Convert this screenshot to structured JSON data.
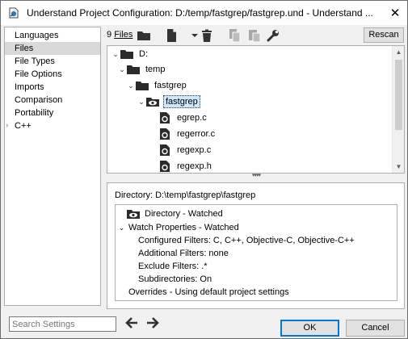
{
  "window": {
    "title": "Understand Project Configuration: D:/temp/fastgrep/fastgrep.und - Understand ...",
    "close_glyph": "✕"
  },
  "sidebar": {
    "items": [
      {
        "label": "Languages"
      },
      {
        "label": "Files"
      },
      {
        "label": "File Types"
      },
      {
        "label": "File Options"
      },
      {
        "label": "Imports"
      },
      {
        "label": "Comparison"
      },
      {
        "label": "Portability"
      },
      {
        "label": "C++"
      }
    ],
    "selected": "Files"
  },
  "toolbar": {
    "files_count_num": "9",
    "files_count_word": "Files",
    "rescan_label": "Rescan"
  },
  "tree": {
    "rows": [
      {
        "label": "D:"
      },
      {
        "label": "temp"
      },
      {
        "label": "fastgrep"
      },
      {
        "label": "fastgrep"
      },
      {
        "label": "egrep.c"
      },
      {
        "label": "regerror.c"
      },
      {
        "label": "regexp.c"
      },
      {
        "label": "regexp.h"
      }
    ],
    "selected": "fastgrep"
  },
  "details": {
    "directory_line": "Directory: D:\\temp\\fastgrep\\fastgrep",
    "directory_status": "Directory - Watched",
    "watch_properties": "Watch Properties - Watched",
    "configured_filters": "Configured Filters: C, C++, Objective-C, Objective-C++",
    "additional_filters": "Additional Filters: none",
    "exclude_filters": "Exclude Filters: .*",
    "subdirectories": "Subdirectories: On",
    "overrides": "Overrides - Using default project settings"
  },
  "footer": {
    "search_placeholder": "Search Settings",
    "ok_label": "OK",
    "cancel_label": "Cancel"
  },
  "colors": {
    "accent": "#0078d7",
    "selection": "#cce8ff",
    "folder": "#2b2b2b"
  }
}
